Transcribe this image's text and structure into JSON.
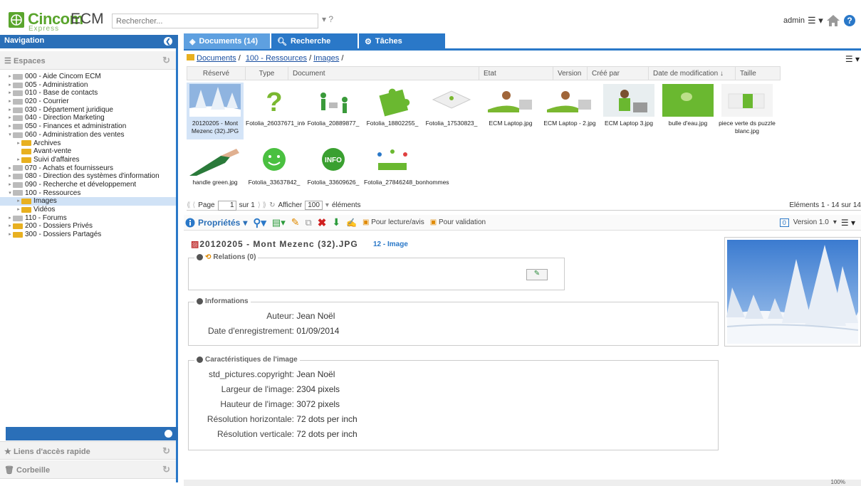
{
  "header": {
    "logo_main": "Cincom",
    "logo_ecm": "ECM",
    "logo_sub": "Express",
    "search_placeholder": "Rechercher...",
    "search_tools": "▾ ?",
    "user": "admin"
  },
  "nav": {
    "title": "Navigation",
    "espaces": "Espaces",
    "liens": "Liens d'accès rapide",
    "corbeille": "Corbeille",
    "tree": [
      {
        "label": "000 - Aide Cincom ECM",
        "level": 0,
        "arrow": "▸",
        "folder": "grey"
      },
      {
        "label": "005 - Administration",
        "level": 0,
        "arrow": "▸",
        "folder": "grey"
      },
      {
        "label": "010 - Base de contacts",
        "level": 0,
        "arrow": "▸",
        "folder": "grey"
      },
      {
        "label": "020 - Courrier",
        "level": 0,
        "arrow": "▸",
        "folder": "grey"
      },
      {
        "label": "030 - Département juridique",
        "level": 0,
        "arrow": "▸",
        "folder": "grey"
      },
      {
        "label": "040 - Direction Marketing",
        "level": 0,
        "arrow": "▸",
        "folder": "grey"
      },
      {
        "label": "050 - Finances et administration",
        "level": 0,
        "arrow": "▸",
        "folder": "grey"
      },
      {
        "label": "060 - Administration des ventes",
        "level": 0,
        "arrow": "▾",
        "folder": "grey"
      },
      {
        "label": "Archives",
        "level": 1,
        "arrow": "▸",
        "folder": "yellow"
      },
      {
        "label": "Avant-vente",
        "level": 1,
        "arrow": "",
        "folder": "yellow"
      },
      {
        "label": "Suivi d'affaires",
        "level": 1,
        "arrow": "▸",
        "folder": "yellow"
      },
      {
        "label": "070 - Achats et fournisseurs",
        "level": 0,
        "arrow": "▸",
        "folder": "grey"
      },
      {
        "label": "080 - Direction des systèmes d'information",
        "level": 0,
        "arrow": "▸",
        "folder": "grey"
      },
      {
        "label": "090 - Recherche et développement",
        "level": 0,
        "arrow": "▸",
        "folder": "grey"
      },
      {
        "label": "100 - Ressources",
        "level": 0,
        "arrow": "▾",
        "folder": "grey"
      },
      {
        "label": "Images",
        "level": 1,
        "arrow": "▸",
        "folder": "yellow",
        "selected": true
      },
      {
        "label": "Vidéos",
        "level": 1,
        "arrow": "▸",
        "folder": "yellow"
      },
      {
        "label": "110 - Forums",
        "level": 0,
        "arrow": "▸",
        "folder": "grey"
      },
      {
        "label": "200 - Dossiers Privés",
        "level": 0,
        "arrow": "▸",
        "folder": "yellow"
      },
      {
        "label": "300 - Dossiers Partagés",
        "level": 0,
        "arrow": "▸",
        "folder": "yellow"
      }
    ]
  },
  "tabs": [
    {
      "label": "Documents (14)"
    },
    {
      "label": "Recherche"
    },
    {
      "label": "Tâches"
    }
  ],
  "breadcrumb": {
    "a": "Documents",
    "b": "100 - Ressources",
    "c": "Images"
  },
  "columns": [
    "Réservé",
    "Type",
    "Document",
    "Etat",
    "Version",
    "Créé par",
    "Date de modification ↓",
    "Taille"
  ],
  "thumbs": [
    {
      "cap": "20120205 - Mont Mezenc (32).JPG",
      "kind": "snow",
      "sel": true
    },
    {
      "cap": "Fotolia_26037671_interrogation.jpg",
      "kind": "question"
    },
    {
      "cap": "Fotolia_20889877_",
      "kind": "men"
    },
    {
      "cap": "Fotolia_18802255_",
      "kind": "puzzle"
    },
    {
      "cap": "Fotolia_17530823_",
      "kind": "white"
    },
    {
      "cap": "ECM Laptop.jpg",
      "kind": "laptop"
    },
    {
      "cap": "ECM Laptop - 2.jpg",
      "kind": "laptop"
    },
    {
      "cap": "ECM Laptop 3.jpg",
      "kind": "laptop3"
    },
    {
      "cap": "bulle d'eau.jpg",
      "kind": "drop"
    },
    {
      "cap": "piece verte ds puzzle blanc.jpg",
      "kind": "piece"
    },
    {
      "cap": "handle green.jpg",
      "kind": "hand"
    },
    {
      "cap": "Fotolia_33637842_",
      "kind": "smile"
    },
    {
      "cap": "Fotolia_33609626_",
      "kind": "info"
    },
    {
      "cap": "Fotolia_27846248_bonhommes",
      "kind": "group"
    }
  ],
  "pager": {
    "page": "Page",
    "num": "1",
    "of": "sur 1",
    "afficher": "Afficher",
    "count": "100",
    "elements": "éléments",
    "total": "Eléments 1 - 14 sur 14"
  },
  "toolbar": {
    "props": "Propriétés",
    "lecture": "Pour lecture/avis",
    "validation": "Pour validation",
    "version": "Version 1.0",
    "badge": "0"
  },
  "detail": {
    "title": "20120205 - Mont Mezenc (32).JPG",
    "tag": "12 - Image",
    "relations": "Relations (0)",
    "informations": "Informations",
    "caract": "Caractéristiques de l'image",
    "info_rows": [
      {
        "k": "Auteur:",
        "v": "Jean Noël"
      },
      {
        "k": "Date d'enregistrement:",
        "v": "01/09/2014"
      }
    ],
    "img_rows": [
      {
        "k": "std_pictures.copyright:",
        "v": "Jean Noël"
      },
      {
        "k": "Largeur de l'image:",
        "v": "2304 pixels"
      },
      {
        "k": "Hauteur de l'image:",
        "v": "3072 pixels"
      },
      {
        "k": "Résolution horizontale:",
        "v": "72 dots per inch"
      },
      {
        "k": "Résolution verticale:",
        "v": "72 dots per inch"
      }
    ]
  },
  "status": {
    "zoom": "100%"
  },
  "colors": {
    "brand": "#5aa52d",
    "nav_blue": "#2a6fb8"
  }
}
